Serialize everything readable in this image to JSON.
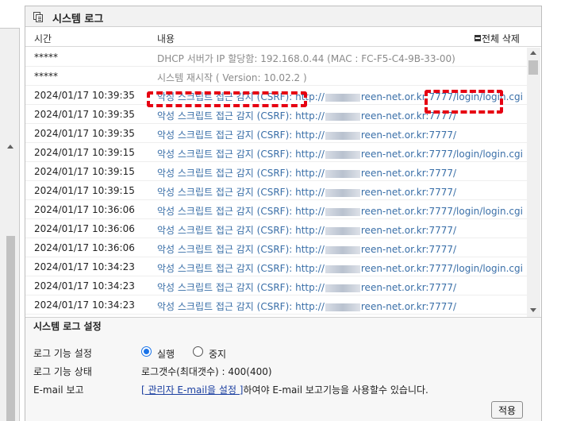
{
  "panel": {
    "title": "시스템 로그",
    "columns": {
      "time": "시간",
      "content": "내용"
    },
    "delete_all_label": "전체 삭제"
  },
  "logs": [
    {
      "time": "*****",
      "content": "DHCP 서버가 IP 할당함: 192.168.0.44 (MAC : FC-F5-C4-9B-33-00)",
      "kind": "system"
    },
    {
      "time": "*****",
      "content": "시스템 재시작 ( Version: 10.02.2 )",
      "kind": "system"
    },
    {
      "time": "2024/01/17 10:39:35",
      "prefix": "악성 스크립트 접근 감지 (CSRF): http://",
      "suffix": "reen-net.or.kr:7777/login/login.cgi",
      "kind": "alert"
    },
    {
      "time": "2024/01/17 10:39:35",
      "prefix": "악성 스크립트 접근 감지 (CSRF): http://",
      "suffix": "reen-net.or.kr:7777/",
      "kind": "alert"
    },
    {
      "time": "2024/01/17 10:39:35",
      "prefix": "악성 스크립트 접근 감지 (CSRF): http://",
      "suffix": "reen-net.or.kr:7777/",
      "kind": "alert"
    },
    {
      "time": "2024/01/17 10:39:15",
      "prefix": "악성 스크립트 접근 감지 (CSRF): http://",
      "suffix": "reen-net.or.kr:7777/login/login.cgi",
      "kind": "alert"
    },
    {
      "time": "2024/01/17 10:39:15",
      "prefix": "악성 스크립트 접근 감지 (CSRF): http://",
      "suffix": "reen-net.or.kr:7777/",
      "kind": "alert"
    },
    {
      "time": "2024/01/17 10:39:15",
      "prefix": "악성 스크립트 접근 감지 (CSRF): http://",
      "suffix": "reen-net.or.kr:7777/",
      "kind": "alert"
    },
    {
      "time": "2024/01/17 10:36:06",
      "prefix": "악성 스크립트 접근 감지 (CSRF): http://",
      "suffix": "reen-net.or.kr:7777/login/login.cgi",
      "kind": "alert"
    },
    {
      "time": "2024/01/17 10:36:06",
      "prefix": "악성 스크립트 접근 감지 (CSRF): http://",
      "suffix": "reen-net.or.kr:7777/",
      "kind": "alert"
    },
    {
      "time": "2024/01/17 10:36:06",
      "prefix": "악성 스크립트 접근 감지 (CSRF): http://",
      "suffix": "reen-net.or.kr:7777/",
      "kind": "alert"
    },
    {
      "time": "2024/01/17 10:34:23",
      "prefix": "악성 스크립트 접근 감지 (CSRF): http://",
      "suffix": "reen-net.or.kr:7777/login/login.cgi",
      "kind": "alert"
    },
    {
      "time": "2024/01/17 10:34:23",
      "prefix": "악성 스크립트 접근 감지 (CSRF): http://",
      "suffix": "reen-net.or.kr:7777/",
      "kind": "alert"
    },
    {
      "time": "2024/01/17 10:34:23",
      "prefix": "악성 스크립트 접근 감지 (CSRF): http://",
      "suffix": "reen-net.or.kr:7777/",
      "kind": "alert"
    }
  ],
  "settings": {
    "title": "시스템 로그 설정",
    "function_setting_label": "로그 기능 설정",
    "radio_run": "실행",
    "radio_stop": "중지",
    "selected": "실행",
    "function_status_label": "로그 기능 상태",
    "status_value": "로그갯수(최대갯수) : 400(400)",
    "email_label": "E-mail 보고",
    "email_link": "[ 관리자 E-mail을 설정 ]",
    "email_text": "하여야 E-mail 보고기능을 사용할수 있습니다.",
    "apply_button": "적용"
  },
  "colors": {
    "alert_text": "#3a6fa8",
    "system_text": "#8a8a8a",
    "highlight": "#e60012",
    "link": "#1b3fa0"
  }
}
